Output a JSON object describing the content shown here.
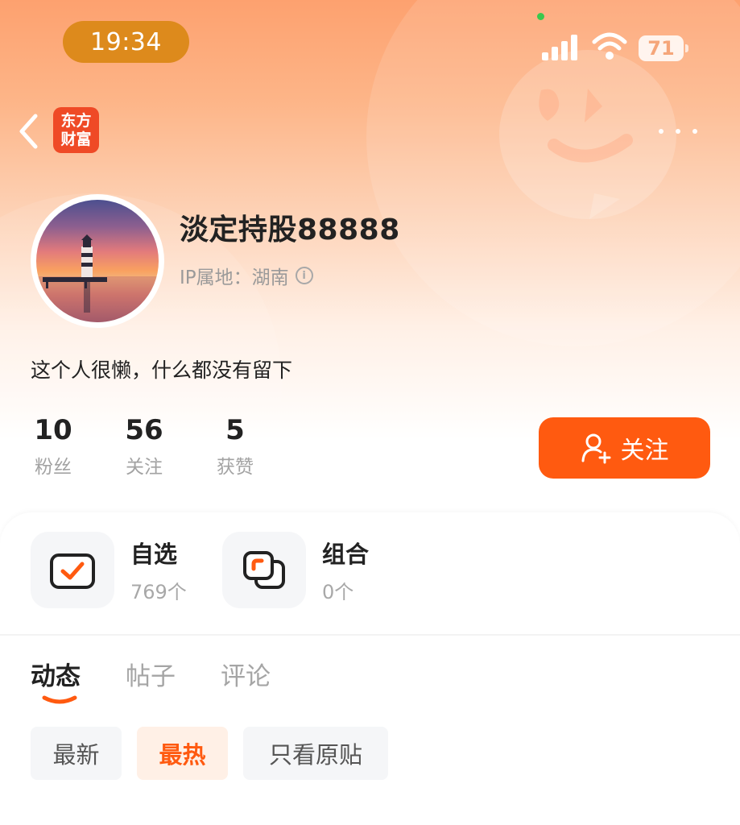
{
  "status_bar": {
    "time": "19:34",
    "battery": "71"
  },
  "nav": {
    "brand_line1": "东方",
    "brand_line2": "财富"
  },
  "profile": {
    "username": "淡定持股88888",
    "ip_location": "IP属地：湖南",
    "bio": "这个人很懒，什么都没有留下",
    "stats": [
      {
        "value": "10",
        "label": "粉丝"
      },
      {
        "value": "56",
        "label": "关注"
      },
      {
        "value": "5",
        "label": "获赞"
      }
    ],
    "follow_label": "关注"
  },
  "quick_links": [
    {
      "title": "自选",
      "count": "769个",
      "icon": "watchlist-check-icon"
    },
    {
      "title": "组合",
      "count": "0个",
      "icon": "portfolio-icon"
    }
  ],
  "tabs": [
    {
      "label": "动态",
      "active": true
    },
    {
      "label": "帖子",
      "active": false
    },
    {
      "label": "评论",
      "active": false
    }
  ],
  "filters": [
    {
      "label": "最新",
      "active": false
    },
    {
      "label": "最热",
      "active": true
    },
    {
      "label": "只看原贴",
      "active": false
    }
  ],
  "colors": {
    "accent": "#ff5a10",
    "header_top": "#fda16f",
    "time_pill": "#dd8a1c"
  }
}
